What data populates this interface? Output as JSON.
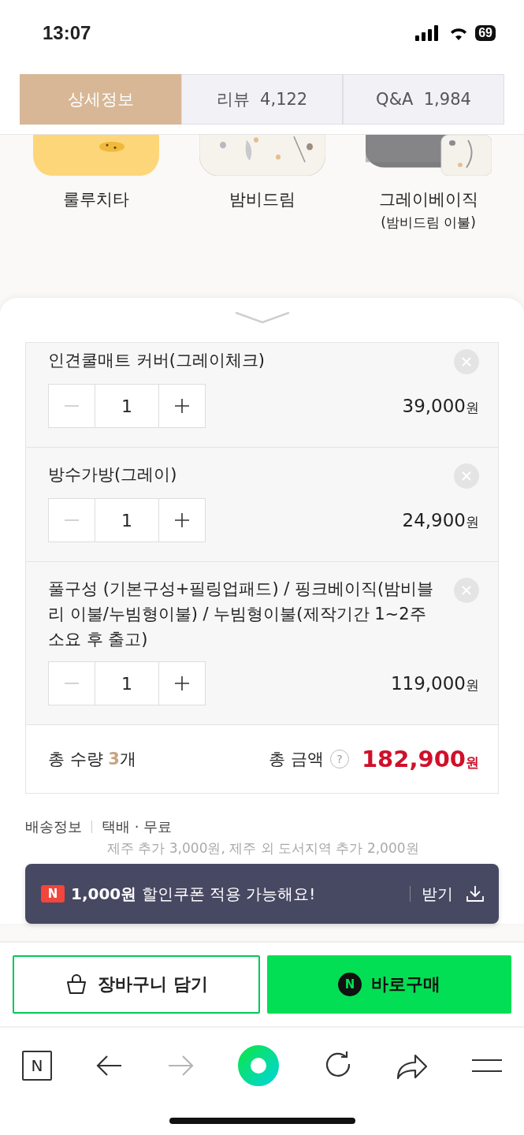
{
  "status_bar": {
    "time": "13:07",
    "battery": "69"
  },
  "tabs": [
    {
      "label": "상세정보",
      "selected": true
    },
    {
      "label": "리뷰",
      "count": "4,122",
      "selected": false
    },
    {
      "label": "Q&A",
      "count": "1,984",
      "selected": false
    }
  ],
  "swatches": [
    {
      "name": "룰루치타",
      "kind": "yellow"
    },
    {
      "name": "밤비드림",
      "kind": "floral"
    },
    {
      "name": "그레이베이직",
      "sub": "(밤비드림 이불)",
      "kind": "gray"
    }
  ],
  "options": [
    {
      "name": "인견쿨매트 커버(그레이체크)",
      "qty": "1",
      "minus_disabled": true,
      "price": "39,000",
      "unit": "원"
    },
    {
      "name": "방수가방(그레이)",
      "qty": "1",
      "minus_disabled": true,
      "price": "24,900",
      "unit": "원"
    },
    {
      "name": "풀구성 (기본구성+필링업패드) / 핑크베이직(밤비블리 이불/누빔형이불) / 누빔형이불(제작기간 1~2주 소요 후 출고)",
      "qty": "1",
      "minus_disabled": true,
      "price": "119,000",
      "unit": "원"
    }
  ],
  "total": {
    "qty_label": "총 수량",
    "qty": "3",
    "qty_unit": "개",
    "amount_label": "총 금액",
    "help": "?",
    "amount": "182,900",
    "amount_unit": "원"
  },
  "shipping": {
    "label": "배송정보",
    "method": "택배 · 무료",
    "note": "제주 추가 3,000원, 제주 외 도서지역 추가 2,000원"
  },
  "coupon": {
    "badge": "N",
    "amount": "1,000원",
    "text": "할인쿠폰 적용 가능해요!",
    "action": "받기"
  },
  "buttons": {
    "cart": "장바구니 담기",
    "buy_badge": "N",
    "buy": "바로구매"
  },
  "toolbar": {
    "home": "N",
    "forward_disabled": true
  }
}
